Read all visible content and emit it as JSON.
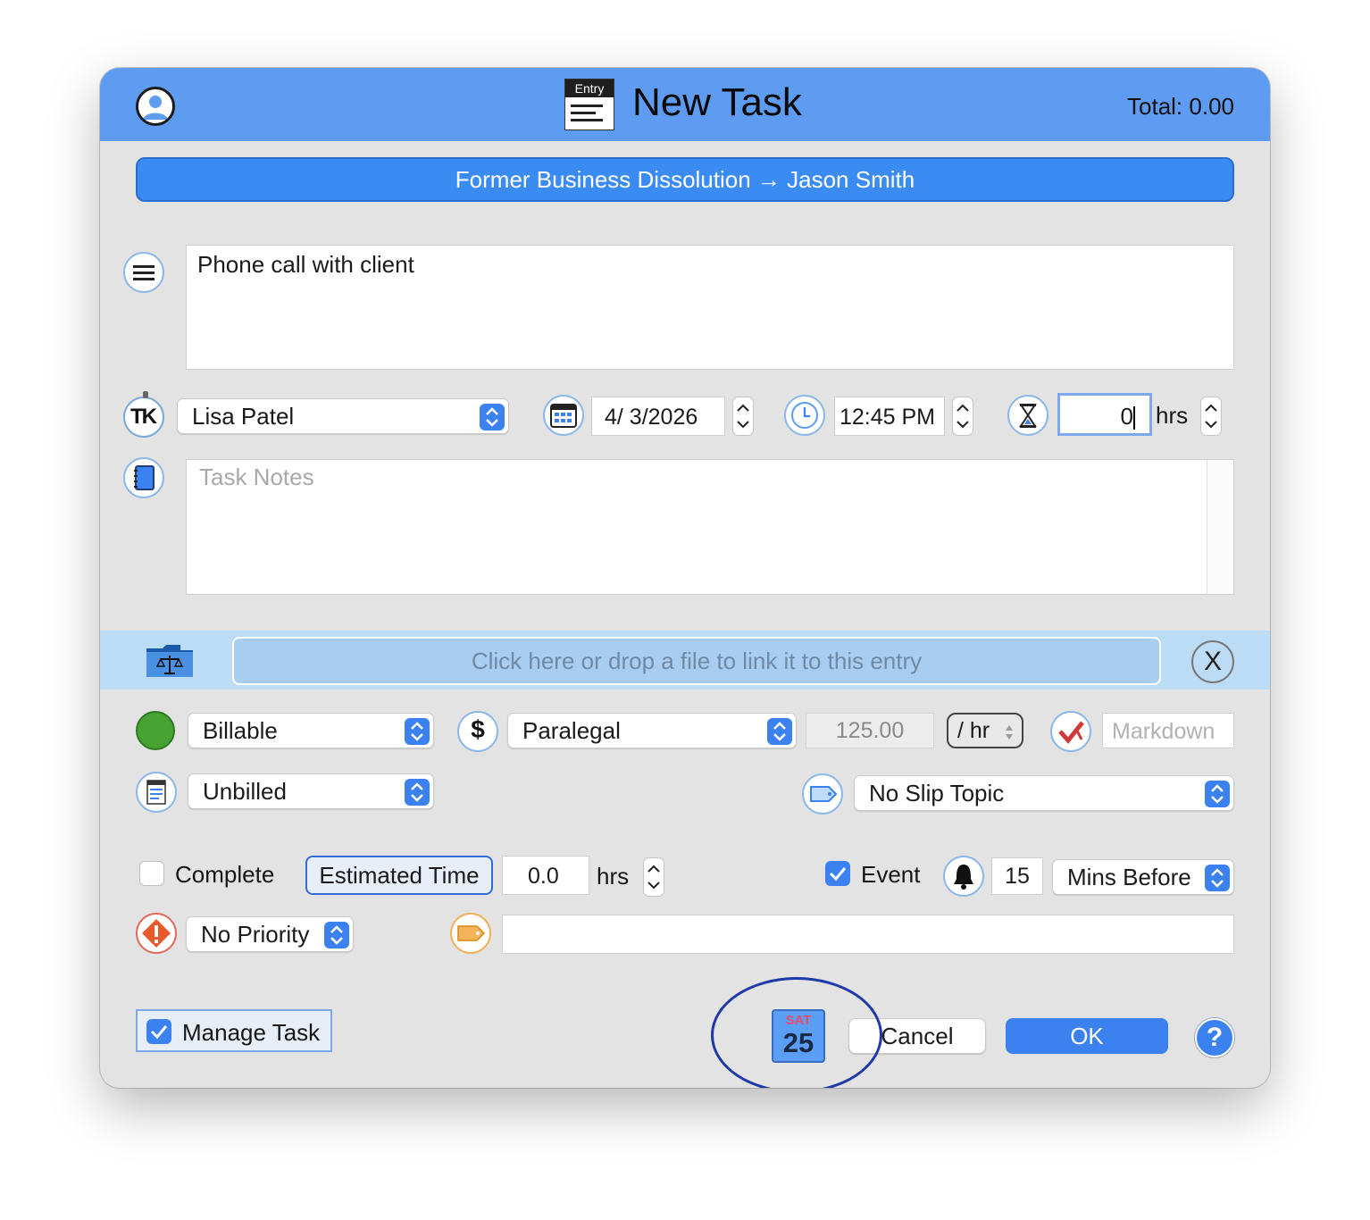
{
  "window": {
    "title": "New Task",
    "total": "Total: 0.00",
    "entry_badge": "Entry"
  },
  "matter": {
    "label": "Former Business Dissolution → Jason Smith"
  },
  "description": {
    "value": "Phone call with client"
  },
  "timekeeper": {
    "selected": "Lisa Patel",
    "icon_text": "TK"
  },
  "date": {
    "value": "4/  3/2026"
  },
  "time": {
    "value": "12:45 PM"
  },
  "duration": {
    "value": "0",
    "unit": "hrs"
  },
  "notes": {
    "placeholder": "Task Notes"
  },
  "file_link": {
    "label": "Click here or drop a file to link it to this entry",
    "clear_label": "X"
  },
  "billing": {
    "status_selected": "Billable",
    "status_color": "#46a332",
    "rate_type_selected": "Paralegal",
    "rate_value": "125.00",
    "rate_unit": "/ hr",
    "markdown_placeholder": "Markdown",
    "invoice_status_selected": "Unbilled",
    "slip_topic_selected": "No Slip Topic"
  },
  "task": {
    "complete_label": "Complete",
    "complete_checked": false,
    "estimated_time_label": "Estimated Time",
    "estimated_time_value": "0.0",
    "estimated_time_unit": "hrs",
    "event_label": "Event",
    "event_checked": true,
    "reminder_minutes": "15",
    "reminder_unit_selected": "Mins Before",
    "priority_selected": "No Priority",
    "tag_value": ""
  },
  "footer": {
    "manage_task_label": "Manage Task",
    "manage_task_checked": true,
    "calendar_day": "SAT",
    "calendar_date": "25",
    "cancel_label": "Cancel",
    "ok_label": "OK",
    "help_label": "?"
  },
  "colors": {
    "titlebar": "#5d9cf0",
    "accent": "#3b82f0",
    "window_bg": "#e3e3e3",
    "file_band": "#bcdcf6"
  }
}
